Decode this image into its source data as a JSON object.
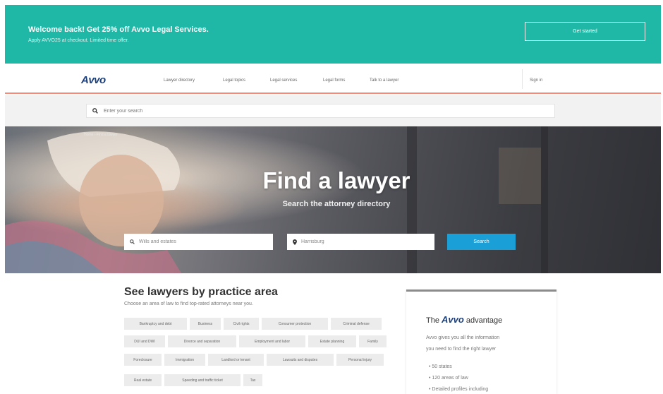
{
  "promo": {
    "title": "Welcome back! Get 25% off Avvo Legal Services.",
    "subtitle": "Apply AVVO25 at checkout. Limited time offer.",
    "button": "Get started",
    "color": "#1fb8a6"
  },
  "nav": {
    "logo": "Avvo",
    "links": [
      "Lawyer directory",
      "Legal topics",
      "Legal services",
      "Legal forms",
      "Talk to a lawyer"
    ],
    "sign_in": "Sign in",
    "accent": "#f28b78"
  },
  "top_search": {
    "placeholder": "Enter your search",
    "icon": "search-icon"
  },
  "hero": {
    "breadcrumbs": "Home  ›  Find a lawyer",
    "title": "Find a lawyer",
    "subtitle": "Search the attorney directory",
    "practice_input": "Wills and estates",
    "location_input": "Harrisburg",
    "search_button": "Search",
    "button_color": "#1a9fd6"
  },
  "practice": {
    "title": "See lawyers by practice area",
    "subtitle": "Choose an area of law to find top-rated attorneys near you.",
    "tags": [
      "Bankruptcy and debt",
      "Business",
      "Civil rights",
      "Consumer protection",
      "Criminal defense",
      "DUI and DWI",
      "Divorce and separation",
      "Employment and labor",
      "Estate planning",
      "Family",
      "Foreclosure",
      "Immigration",
      "Landlord or tenant",
      "Lawsuits and disputes",
      "Personal injury",
      "Real estate",
      "Speeding and traffic ticket",
      "Tax"
    ]
  },
  "advantage": {
    "title_prefix": "The",
    "title_brand": "Avvo",
    "title_suffix": "advantage",
    "text_line1": "Avvo gives you all the information",
    "text_line2": "you need to find the right lawyer",
    "bullets": [
      "• 50 states",
      "• 120 areas of law",
      "• Detailed profiles including"
    ]
  }
}
